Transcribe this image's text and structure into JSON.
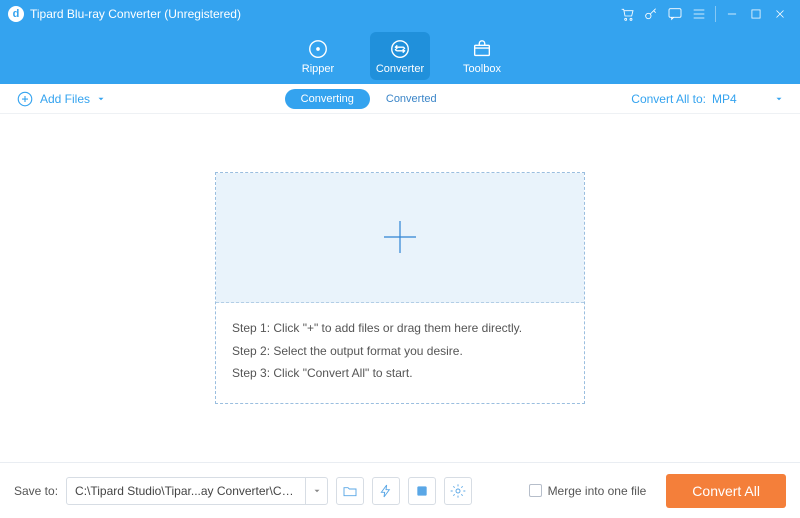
{
  "titlebar": {
    "title": "Tipard Blu-ray Converter (Unregistered)"
  },
  "nav": {
    "ripper": "Ripper",
    "converter": "Converter",
    "toolbox": "Toolbox"
  },
  "toolbar": {
    "add_files": "Add Files",
    "seg_converting": "Converting",
    "seg_converted": "Converted",
    "convert_all_to": "Convert All to:",
    "format": "MP4"
  },
  "steps": {
    "s1": "Step 1: Click \"+\" to add files or drag them here directly.",
    "s2": "Step 2: Select the output format you desire.",
    "s3": "Step 3: Click \"Convert All\" to start."
  },
  "bottom": {
    "save_to": "Save to:",
    "path": "C:\\Tipard Studio\\Tipar...ay Converter\\Converted",
    "merge": "Merge into one file",
    "convert_all": "Convert All"
  }
}
